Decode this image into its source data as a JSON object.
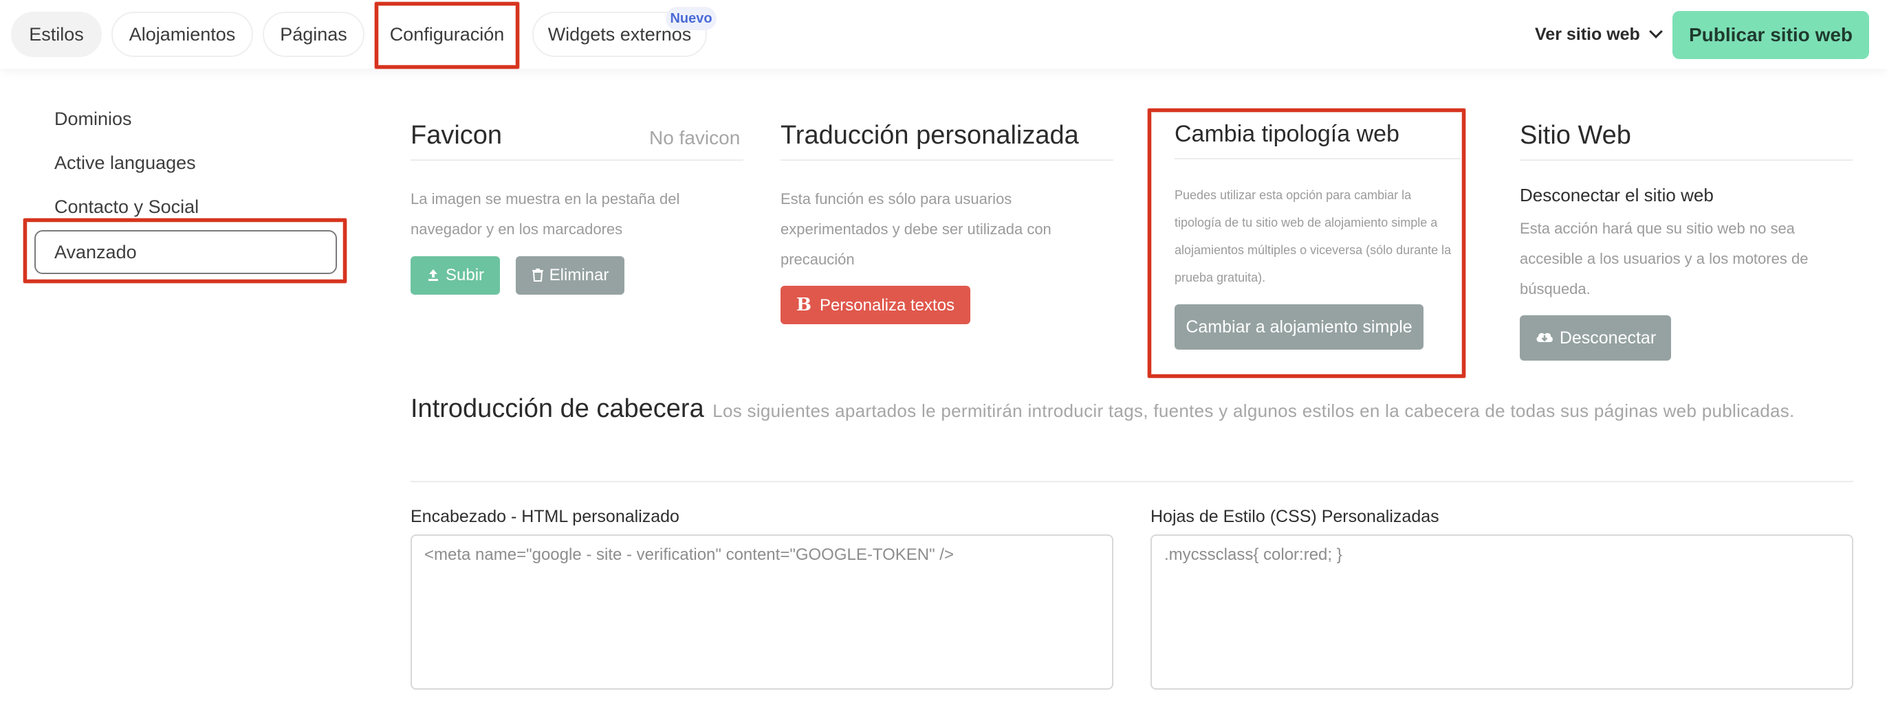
{
  "nav": {
    "tabs": [
      {
        "label": "Estilos"
      },
      {
        "label": "Alojamientos"
      },
      {
        "label": "Páginas"
      },
      {
        "label": "Configuración"
      },
      {
        "label": "Widgets externos"
      }
    ],
    "new_badge": "Nuevo",
    "view_site": "Ver sitio web",
    "publish": "Publicar sitio web"
  },
  "sidebar": {
    "items": [
      {
        "label": "Dominios"
      },
      {
        "label": "Active languages"
      },
      {
        "label": "Contacto y Social"
      },
      {
        "label": "Avanzado"
      }
    ]
  },
  "favicon": {
    "title": "Favicon",
    "status": "No favicon",
    "description": "La imagen se muestra en la pestaña del navegador y en los marcadores",
    "upload": "Subir",
    "delete": "Eliminar"
  },
  "translation": {
    "title": "Traducción personalizada",
    "description": "Esta función es sólo para usuarios experimentados y debe ser utilizada con precaución",
    "button": "Personaliza textos"
  },
  "typology": {
    "title": "Cambia tipología web",
    "description": "Puedes utilizar esta opción para cambiar la tipología de tu sitio web de alojamiento simple a alojamientos múltiples o viceversa (sólo durante la prueba gratuita).",
    "button": "Cambiar a alojamiento simple"
  },
  "website": {
    "title": "Sitio Web",
    "subtitle": "Desconectar el sitio web",
    "description": "Esta acción hará que su sitio web no sea accesible a los usuarios y a los motores de búsqueda.",
    "button": "Desconectar"
  },
  "header_intro": {
    "title": "Introducción de cabecera",
    "description": "Los siguientes apartados le permitirán introducir tags, fuentes y algunos estilos en la cabecera de todas sus páginas web publicadas."
  },
  "html_field": {
    "label": "Encabezado - HTML personalizado",
    "placeholder": "<meta name=\"google - site - verification\" content=\"GOOGLE-TOKEN\" />"
  },
  "css_field": {
    "label": "Hojas de Estilo (CSS) Personalizadas",
    "placeholder": ".mycssclass{ color:red; }"
  },
  "colors": {
    "publish": "#7ce0b5",
    "upload": "#6cc3a0",
    "secondary": "#96a2a2",
    "translate": "#e0584c",
    "highlight": "#d6341f"
  }
}
